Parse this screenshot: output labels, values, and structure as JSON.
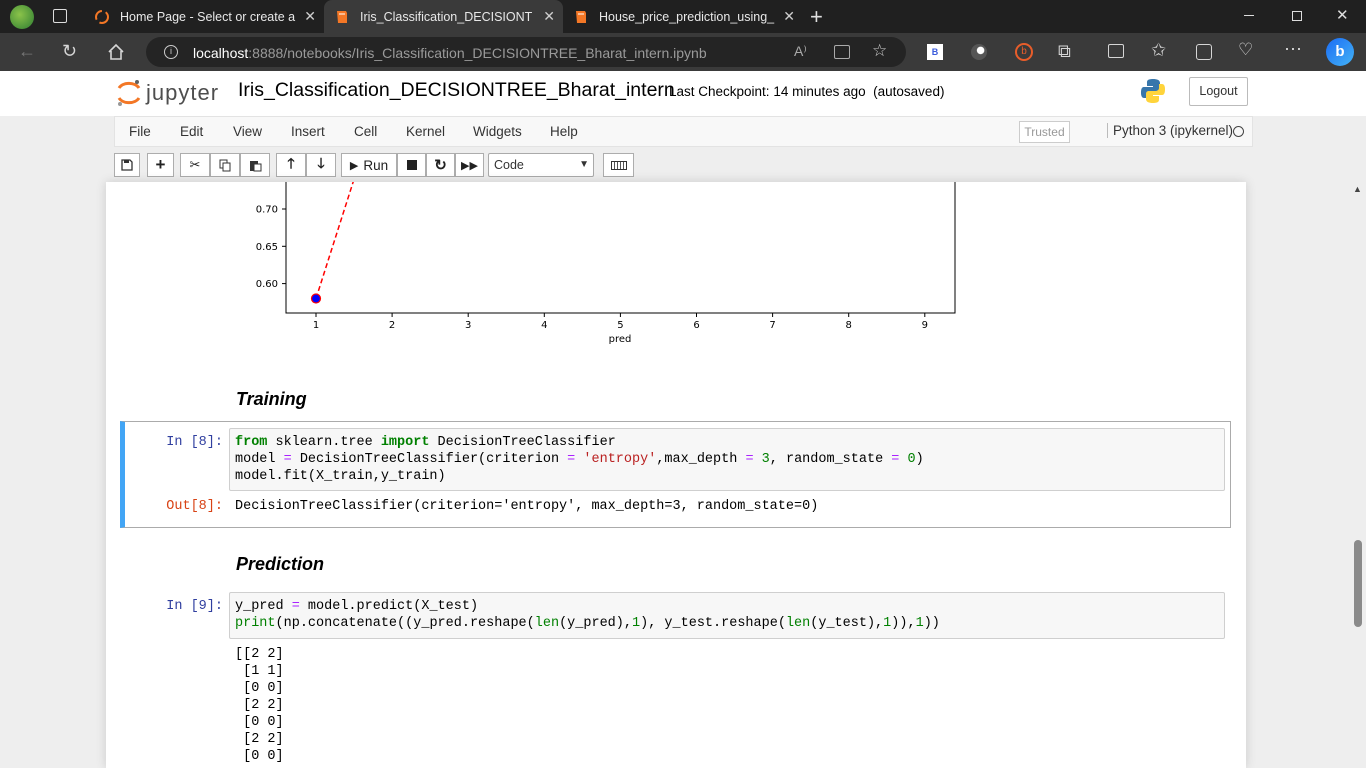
{
  "browser": {
    "tabs": [
      {
        "title": "Home Page - Select or create a n",
        "active": false
      },
      {
        "title": "Iris_Classification_DECISIONTRE",
        "active": true
      },
      {
        "title": "House_price_prediction_using_Lir",
        "active": false
      }
    ],
    "url_host": "localhost",
    "url_rest": ":8888/notebooks/Iris_Classification_DECISIONTREE_Bharat_intern.ipynb"
  },
  "jupyter": {
    "logo_text": "jupyter",
    "notebook_title": "Iris_Classification_DECISIONTREE_Bharat_intern",
    "checkpoint_label": "Last Checkpoint:",
    "checkpoint_time": "14 minutes ago",
    "autosaved": "(autosaved)",
    "logout": "Logout",
    "menu": [
      "File",
      "Edit",
      "View",
      "Insert",
      "Cell",
      "Kernel",
      "Widgets",
      "Help"
    ],
    "trusted": "Trusted",
    "kernel": "Python 3 (ipykernel)",
    "run_label": "Run",
    "cell_type": "Code"
  },
  "plot": {
    "y_ticks": [
      "0.70",
      "0.65",
      "0.60"
    ],
    "x_ticks": [
      "1",
      "2",
      "3",
      "4",
      "5",
      "6",
      "7",
      "8",
      "9"
    ],
    "xlabel": "pred"
  },
  "chart_data": {
    "type": "line",
    "xlabel": "pred",
    "ylabel": "",
    "xlim": [
      0.6,
      9.4
    ],
    "series": [
      {
        "x": [
          1,
          1.5
        ],
        "y": [
          0.58,
          0.74
        ],
        "color": "#ff0000",
        "style": "dashed"
      }
    ],
    "markers": [
      {
        "x": 1,
        "y": 0.58,
        "fill": "#0000ff",
        "edge": "#ff0000"
      }
    ]
  },
  "cells": {
    "training_heading": "Training",
    "prediction_heading": "Prediction",
    "in8_prompt": "In [8]:",
    "out8_prompt": "Out[8]:",
    "out8_text": "DecisionTreeClassifier(criterion='entropy', max_depth=3, random_state=0)",
    "in9_prompt": "In [9]:",
    "in9_output": "[[2 2]\n [1 1]\n [0 0]\n [2 2]\n [0 0]\n [2 2]\n [0 0]"
  }
}
